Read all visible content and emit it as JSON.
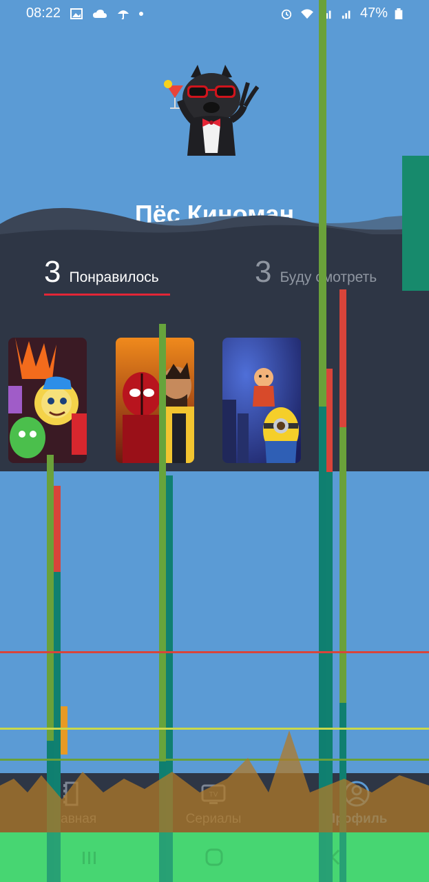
{
  "status_bar": {
    "time": "08:22",
    "left_icons": [
      "image-icon",
      "cloud-icon",
      "umbrella-icon",
      "dot-icon"
    ],
    "right_icons": [
      "alarm-icon",
      "wifi-icon",
      "signal-icon",
      "roaming-signal-icon",
      "battery-icon"
    ],
    "battery": "47%"
  },
  "profile": {
    "name": "Пёс Киноман",
    "avatar_icon": "bulldog-with-sunglasses-and-cocktail"
  },
  "stats": {
    "liked_count": "3",
    "liked_label": "Понравилось",
    "watch_count": "3",
    "watch_label": "Буду смотреть",
    "active_tab": "liked"
  },
  "posters": [
    {
      "name": "poster-animated-emotions"
    },
    {
      "name": "poster-red-masked-hero"
    },
    {
      "name": "poster-minion-baby"
    }
  ],
  "bottom_nav": {
    "items": [
      {
        "label": "Главная",
        "icon": "film-icon"
      },
      {
        "label": "Сериалы",
        "icon": "tv-icon"
      },
      {
        "label": "Профиль",
        "icon": "profile-icon",
        "active": true
      }
    ]
  },
  "system_nav": {
    "icons": [
      "recents-icon",
      "home-icon",
      "back-icon"
    ]
  },
  "colors": {
    "background": "#5b9bd5",
    "panel": "#2e3645",
    "accent": "#e32636",
    "active_nav": "#5b9bd5"
  }
}
